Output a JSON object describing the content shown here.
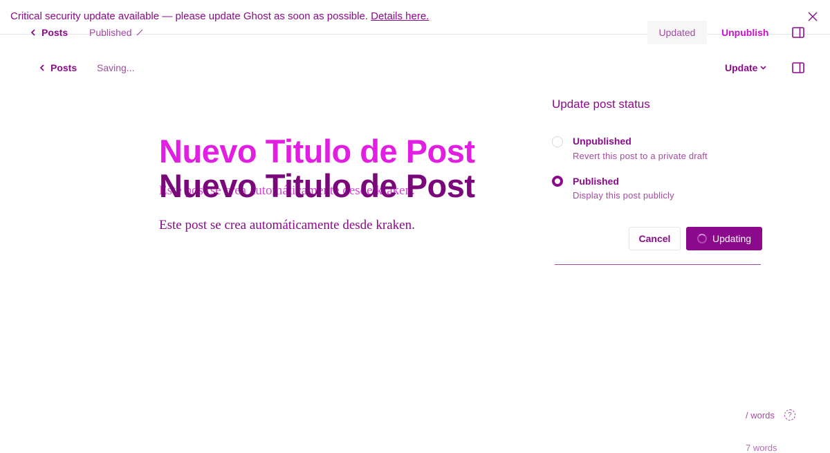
{
  "banner": {
    "message": "Critical security update available — please update Ghost as soon as possible.",
    "link": "Details here."
  },
  "ghost_header": {
    "back_label": "Posts",
    "status": "Published",
    "updated_label": "Updated",
    "unpublish_label": "Unpublish"
  },
  "header": {
    "back_label": "Posts",
    "status": "Saving...",
    "update_label": "Update"
  },
  "editor": {
    "title_front": "Nuevo Titulo de Post",
    "title_back": "Nuevo Titulo de Post",
    "body_ghost": "Este post se crea automáticamente desde kraken.",
    "body": "Este post se crea automáticamente desde kraken."
  },
  "publish_panel": {
    "heading": "Update post status",
    "options": [
      {
        "label": "Unpublished",
        "description": "Revert this post to a private draft",
        "selected": false
      },
      {
        "label": "Published",
        "description": "Display this post publicly",
        "selected": true
      }
    ],
    "cancel_label": "Cancel",
    "updating_label": "Updating"
  },
  "footer": {
    "word_count": "/ words",
    "help": "?",
    "ghost_word_count": "7 words"
  },
  "colors": {
    "accent": "#8b0a8b",
    "title_highlight": "#e11ee1",
    "muted": "#a24aa2"
  }
}
